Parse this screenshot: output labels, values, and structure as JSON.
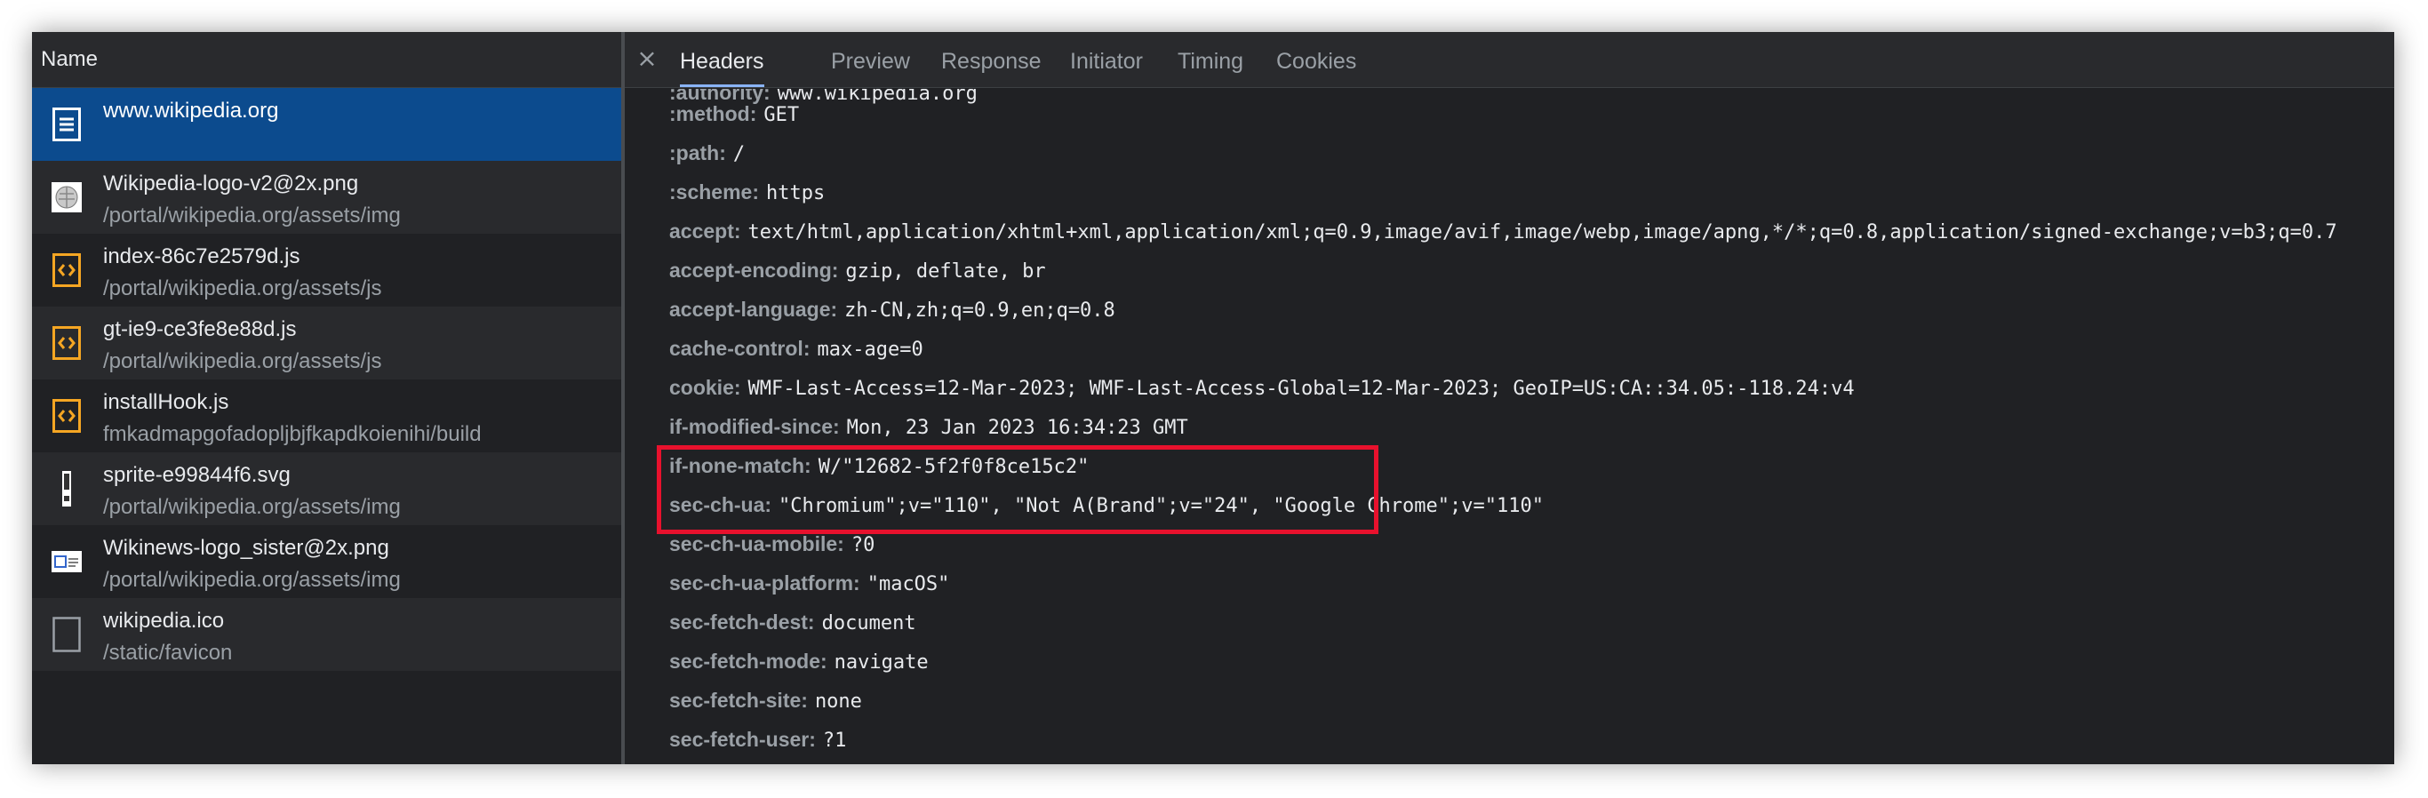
{
  "requests_panel": {
    "column_header": "Name",
    "items": [
      {
        "name": "www.wikipedia.org",
        "path": "",
        "icon": "document-icon",
        "selected": true
      },
      {
        "name": "Wikipedia-logo-v2@2x.png",
        "path": "/portal/wikipedia.org/assets/img",
        "icon": "image-thumbnail-icon"
      },
      {
        "name": "index-86c7e2579d.js",
        "path": "/portal/wikipedia.org/assets/js",
        "icon": "script-icon"
      },
      {
        "name": "gt-ie9-ce3fe8e88d.js",
        "path": "/portal/wikipedia.org/assets/js",
        "icon": "script-icon"
      },
      {
        "name": "installHook.js",
        "path": "fmkadmapgofadopljbjfkapdkoienihi/build",
        "icon": "script-icon"
      },
      {
        "name": "sprite-e99844f6.svg",
        "path": "/portal/wikipedia.org/assets/img",
        "icon": "svg-thumbnail-icon"
      },
      {
        "name": "Wikinews-logo_sister@2x.png",
        "path": "/portal/wikipedia.org/assets/img",
        "icon": "image-thumbnail-icon"
      },
      {
        "name": "wikipedia.ico",
        "path": "/static/favicon",
        "icon": "blank-file-icon"
      }
    ]
  },
  "details_panel": {
    "close_label": "×",
    "tabs": [
      "Headers",
      "Preview",
      "Response",
      "Initiator",
      "Timing",
      "Cookies"
    ],
    "active_tab": "Headers",
    "headers": [
      {
        "key": ":authority:",
        "value": "www.wikipedia.org"
      },
      {
        "key": ":method:",
        "value": "GET"
      },
      {
        "key": ":path:",
        "value": "/"
      },
      {
        "key": ":scheme:",
        "value": "https"
      },
      {
        "key": "accept:",
        "value": "text/html,application/xhtml+xml,application/xml;q=0.9,image/avif,image/webp,image/apng,*/*;q=0.8,application/signed-exchange;v=b3;q=0.7"
      },
      {
        "key": "accept-encoding:",
        "value": "gzip, deflate, br"
      },
      {
        "key": "accept-language:",
        "value": "zh-CN,zh;q=0.9,en;q=0.8"
      },
      {
        "key": "cache-control:",
        "value": "max-age=0"
      },
      {
        "key": "cookie:",
        "value": "WMF-Last-Access=12-Mar-2023; WMF-Last-Access-Global=12-Mar-2023; GeoIP=US:CA::34.05:-118.24:v4"
      },
      {
        "key": "if-modified-since:",
        "value": "Mon, 23 Jan 2023 16:34:23 GMT"
      },
      {
        "key": "if-none-match:",
        "value": "W/\"12682-5f2f0f8ce15c2\""
      },
      {
        "key": "sec-ch-ua:",
        "value": "\"Chromium\";v=\"110\", \"Not A(Brand\";v=\"24\", \"Google Chrome\";v=\"110\""
      },
      {
        "key": "sec-ch-ua-mobile:",
        "value": "?0"
      },
      {
        "key": "sec-ch-ua-platform:",
        "value": "\"macOS\""
      },
      {
        "key": "sec-fetch-dest:",
        "value": "document"
      },
      {
        "key": "sec-fetch-mode:",
        "value": "navigate"
      },
      {
        "key": "sec-fetch-site:",
        "value": "none"
      },
      {
        "key": "sec-fetch-user:",
        "value": "?1"
      }
    ]
  },
  "colors": {
    "background": "#202124",
    "selection": "#0c4b8e",
    "script_icon": "#f5a623",
    "highlight_box": "#e8112d",
    "active_tab_underline": "#8ab4f8"
  }
}
